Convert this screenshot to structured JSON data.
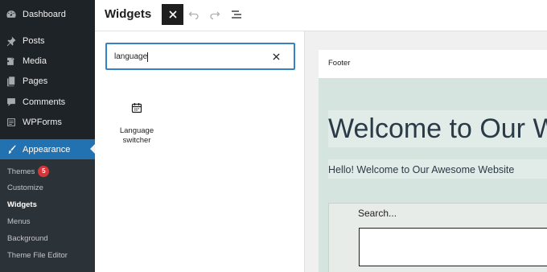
{
  "sidebar": {
    "items": [
      {
        "label": "Dashboard",
        "icon": "dashboard-icon"
      },
      {
        "label": "Posts",
        "icon": "pushpin-icon"
      },
      {
        "label": "Media",
        "icon": "media-icon"
      },
      {
        "label": "Pages",
        "icon": "pages-icon"
      },
      {
        "label": "Comments",
        "icon": "comments-icon"
      },
      {
        "label": "WPForms",
        "icon": "wpforms-icon"
      },
      {
        "label": "Appearance",
        "icon": "brush-icon"
      }
    ],
    "submenu": [
      {
        "label": "Themes",
        "badge": "5"
      },
      {
        "label": "Customize"
      },
      {
        "label": "Widgets"
      },
      {
        "label": "Menus"
      },
      {
        "label": "Background"
      },
      {
        "label": "Theme File Editor"
      }
    ]
  },
  "header": {
    "title": "Widgets",
    "toolbar": [
      "close-icon",
      "undo-icon",
      "redo-icon",
      "list-view-icon"
    ]
  },
  "inserter": {
    "search_value": "language",
    "results": [
      {
        "label": "Language switcher",
        "icon": "calendar-icon"
      }
    ]
  },
  "canvas": {
    "area_label": "Footer",
    "heading": "Welcome to Our Website",
    "paragraph": "Hello! Welcome to Our Awesome Website",
    "search_label": "Search..."
  },
  "colors": {
    "sidebar_bg": "#1d2327",
    "submenu_bg": "#2c3338",
    "accent": "#2271b1",
    "badge": "#d63638",
    "focus": "#3582c4",
    "canvas_area": "#d5e4de"
  }
}
